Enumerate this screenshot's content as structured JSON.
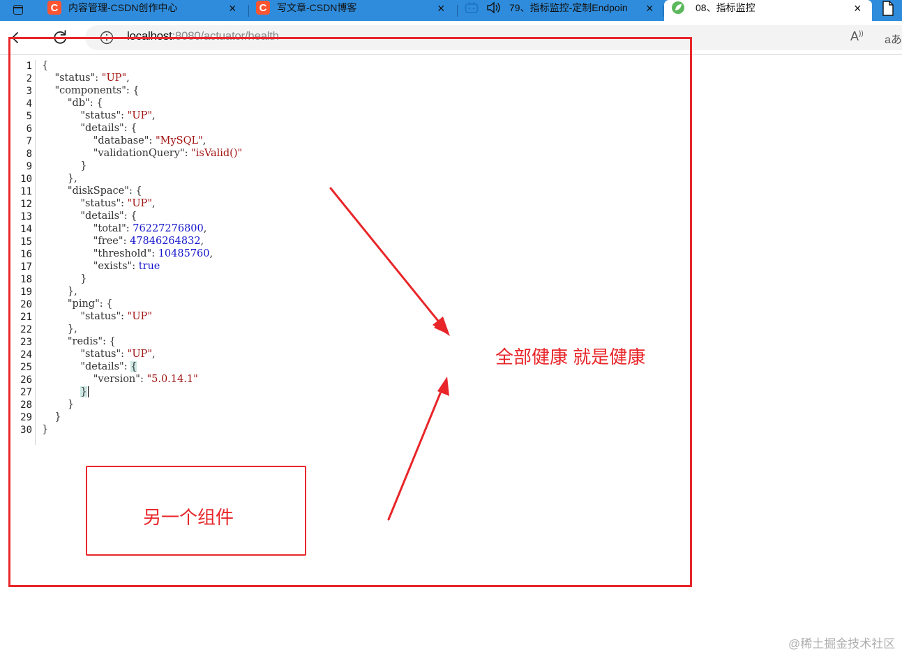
{
  "tabs": [
    {
      "title": "内容管理-CSDN创作中心",
      "icon": "csdn-logo-icon",
      "active": false
    },
    {
      "title": "写文章-CSDN博客",
      "icon": "csdn-logo-icon",
      "active": false
    },
    {
      "title": "79、指标监控-定制Endpoin",
      "icon": "bilibili-icon",
      "active": false
    },
    {
      "title": "08、指标监控",
      "icon": "leaf-icon",
      "active": true
    }
  ],
  "tab_close_label": "×",
  "address_bar": {
    "url_host": "localhost",
    "url_rest": ":8080/actuator/health"
  },
  "csdn_logo_letter": "C",
  "json_viewer": {
    "line_numbers": [
      "1",
      "2",
      "3",
      "4",
      "5",
      "6",
      "7",
      "8",
      "9",
      "10",
      "11",
      "12",
      "13",
      "14",
      "15",
      "16",
      "17",
      "18",
      "19",
      "20",
      "21",
      "22",
      "23",
      "24",
      "25",
      "26",
      "27",
      "28",
      "29",
      "30"
    ],
    "lines": {
      "l1": "{",
      "l2_key": "\"status\"",
      "l2_val": "\"UP\"",
      "l3_key": "\"components\"",
      "l4_key": "\"db\"",
      "l5_key": "\"status\"",
      "l5_val": "\"UP\"",
      "l6_key": "\"details\"",
      "l7_key": "\"database\"",
      "l7_val": "\"MySQL\"",
      "l8_key": "\"validationQuery\"",
      "l8_val": "\"isValid()\"",
      "l11_key": "\"diskSpace\"",
      "l12_key": "\"status\"",
      "l12_val": "\"UP\"",
      "l13_key": "\"details\"",
      "l14_key": "\"total\"",
      "l14_val": "76227276800",
      "l15_key": "\"free\"",
      "l15_val": "47846264832",
      "l16_key": "\"threshold\"",
      "l16_val": "10485760",
      "l17_key": "\"exists\"",
      "l17_val": "true",
      "l20_key": "\"ping\"",
      "l21_key": "\"status\"",
      "l21_val": "\"UP\"",
      "l23_key": "\"redis\"",
      "l24_key": "\"status\"",
      "l24_val": "\"UP\"",
      "l25_key": "\"details\"",
      "l26_key": "\"version\"",
      "l26_val": "\"5.0.14.1\""
    }
  },
  "annotations": {
    "all_healthy": "全部健康 就是健康",
    "another_component": "另一个组件",
    "color": "#e8262a"
  },
  "watermark": "@稀土掘金技术社区"
}
